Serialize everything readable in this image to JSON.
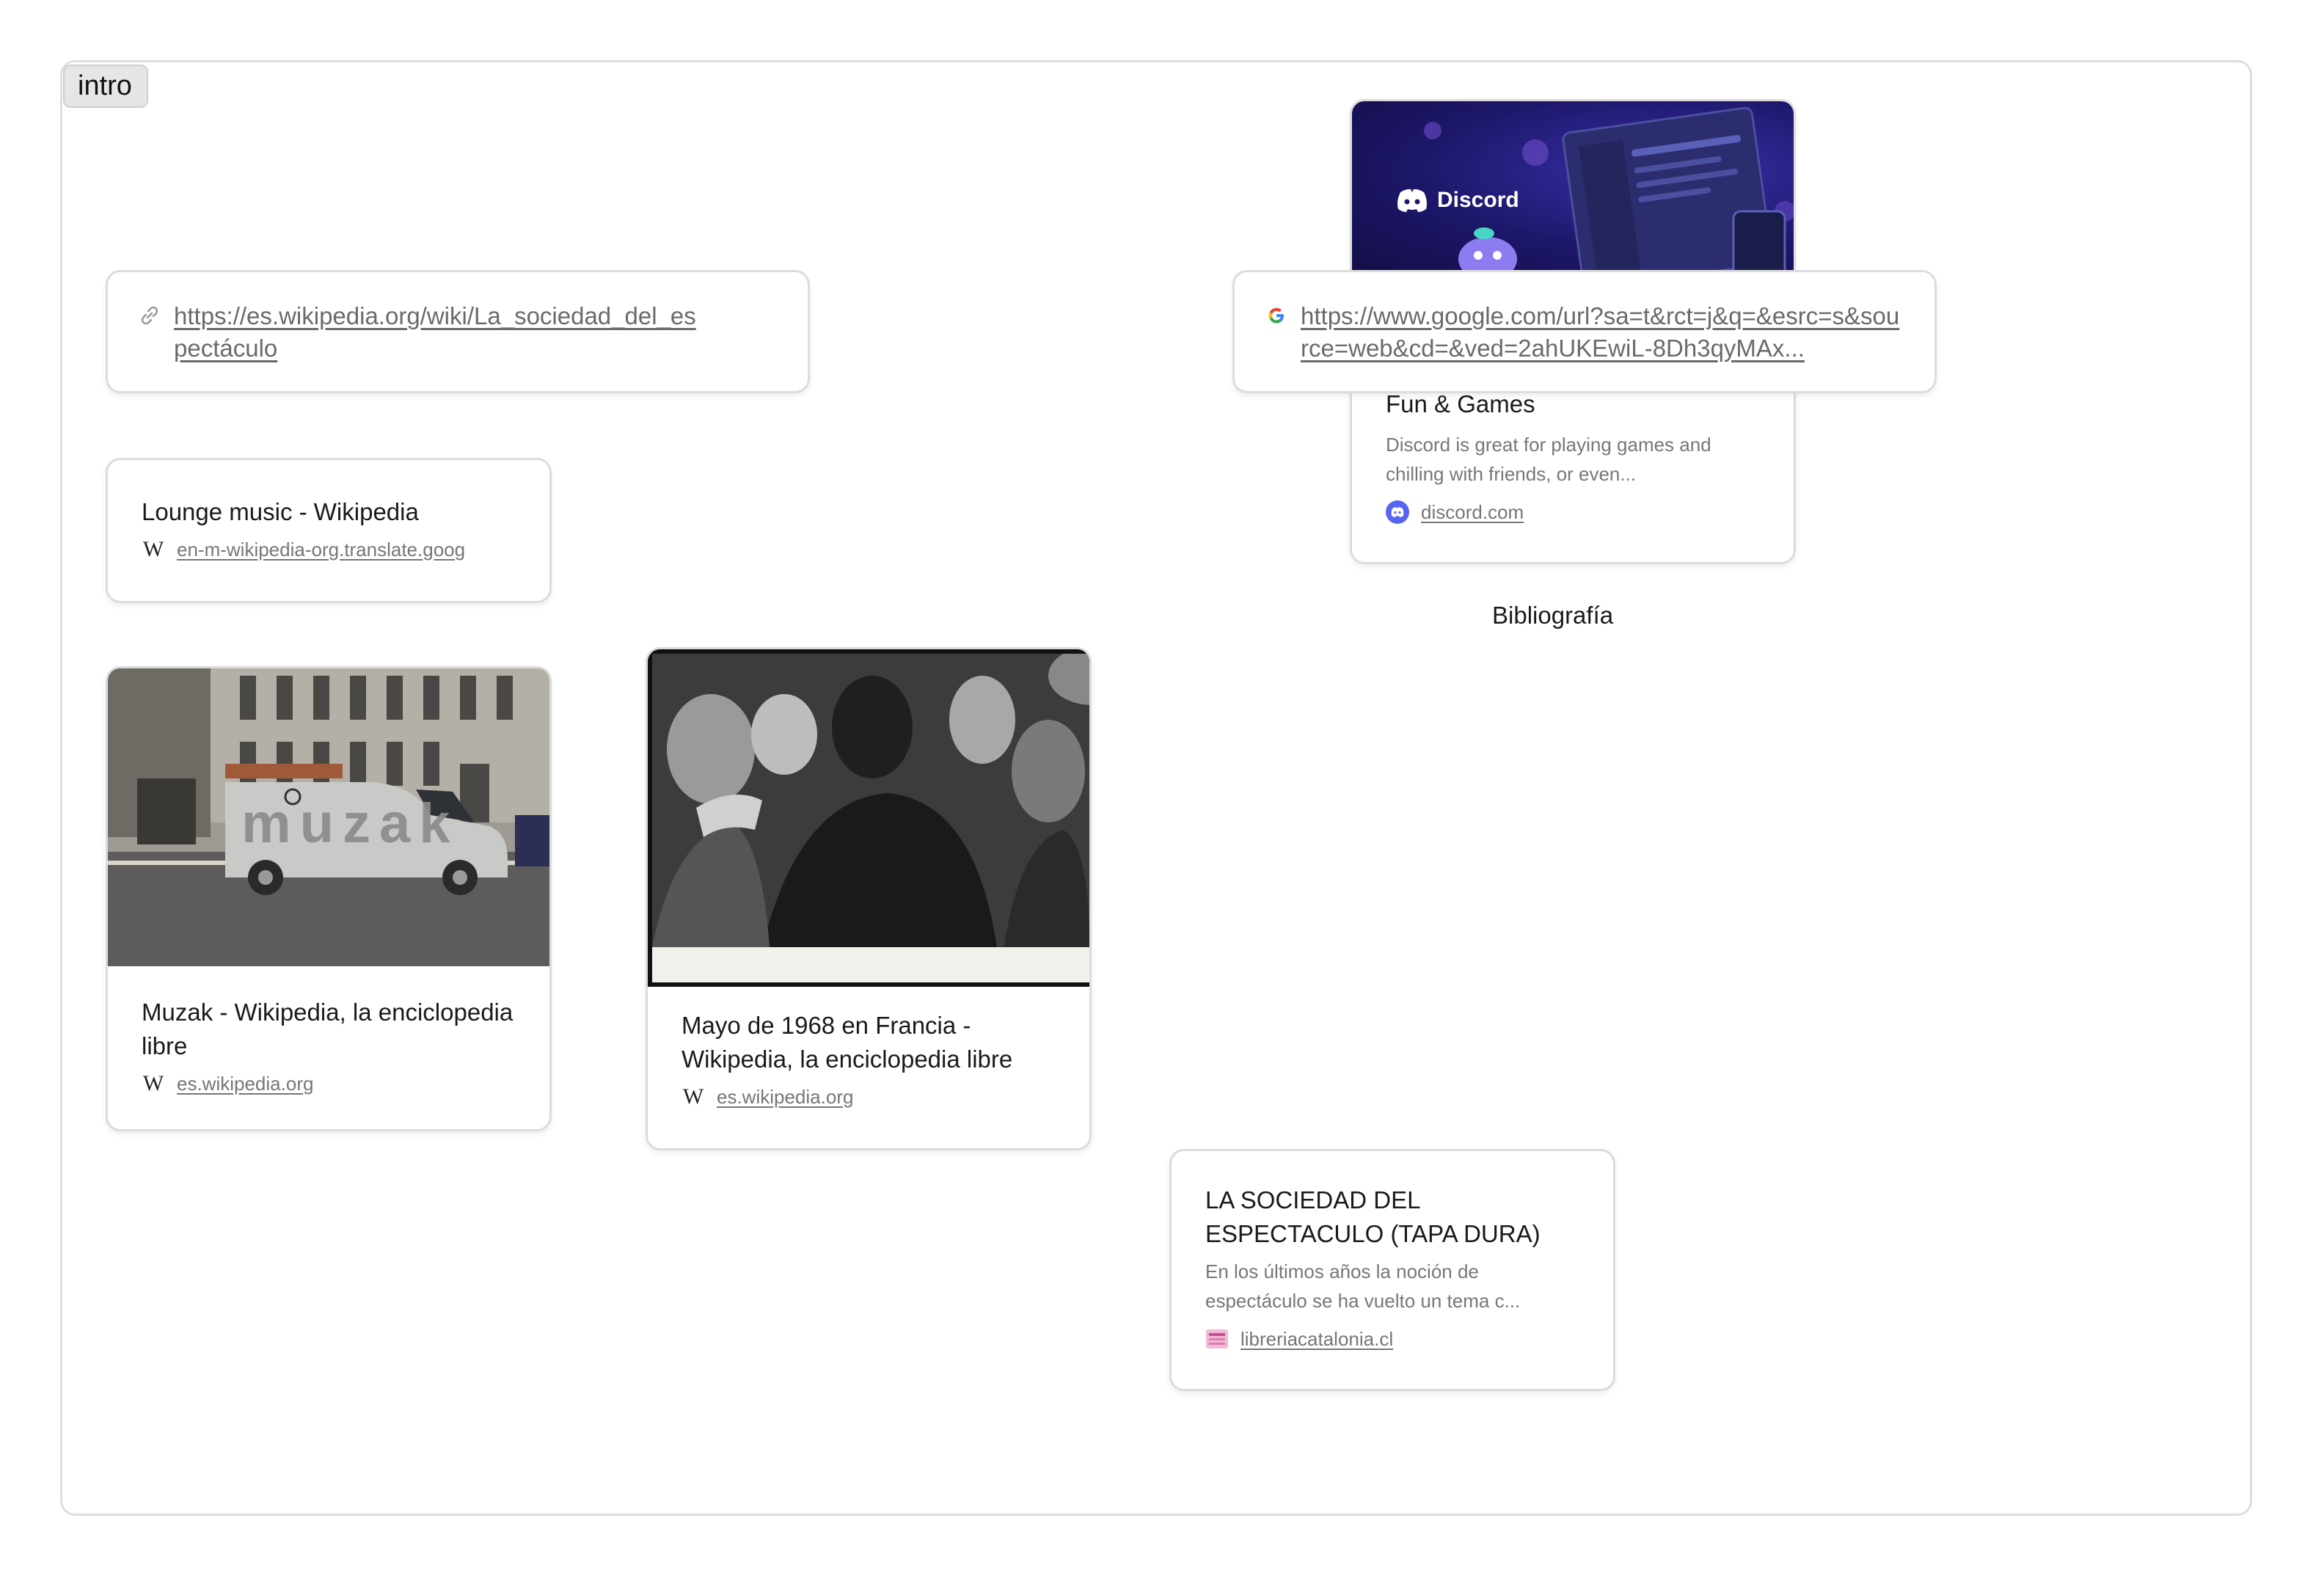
{
  "board": {
    "label": "intro",
    "caption": "Bibliografía"
  },
  "link_wiki": {
    "url": "https://es.wikipedia.org/wiki/La_sociedad_del_espectáculo",
    "icon": "link-icon"
  },
  "link_google": {
    "url": "https://www.google.com/url?sa=t&rct=j&q=&esrc=s&source=web&cd=&ved=2ahUKEwiL-8Dh3qyMAx...",
    "icon": "google-icon"
  },
  "card_lounge": {
    "title": "Lounge music - Wikipedia",
    "source": "en-m-wikipedia-org.translate.goog",
    "favicon": "wikipedia-icon"
  },
  "card_discord": {
    "image_brand": "Discord",
    "title": "Fun & Games",
    "description": "Discord is great for playing games and chilling with friends, or even...",
    "source": "discord.com",
    "favicon": "discord-icon"
  },
  "card_muzak": {
    "image_text": "muzak",
    "title": "Muzak - Wikipedia, la enciclopedia libre",
    "source": "es.wikipedia.org",
    "favicon": "wikipedia-icon"
  },
  "card_mayo": {
    "title": "Mayo de 1968 en Francia - Wikipedia, la enciclopedia libre",
    "source": "es.wikipedia.org",
    "favicon": "wikipedia-icon"
  },
  "card_sociedad": {
    "title": "LA SOCIEDAD DEL ESPECTACULO (TAPA DURA)",
    "description": "En los últimos años la noción de espectáculo se ha vuelto un tema c...",
    "source": "libreriacatalonia.cl",
    "favicon": "libreria-icon"
  },
  "colors": {
    "discord_bg": "#1e1b6b",
    "discord_brand": "#5865f2",
    "border": "#dcdcdc"
  }
}
